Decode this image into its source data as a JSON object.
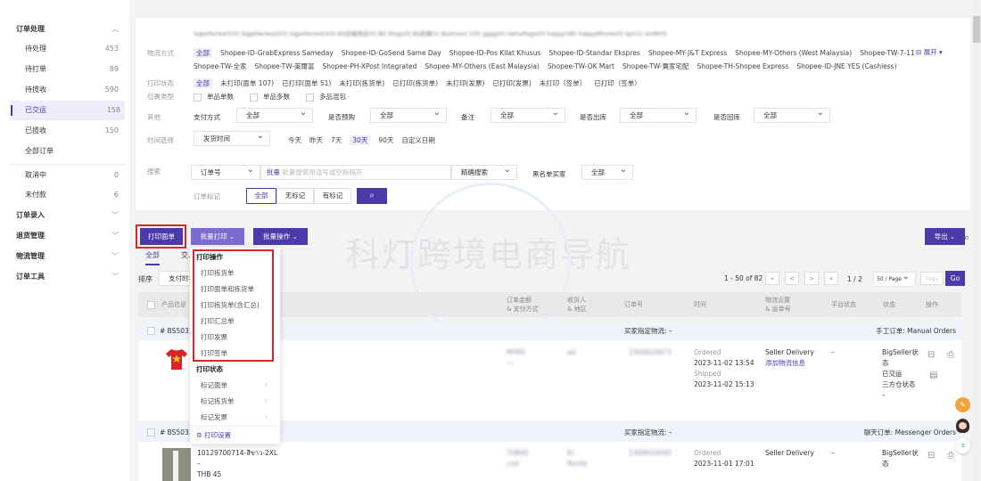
{
  "sidebar": {
    "groups": [
      {
        "label": "订单处理",
        "items": [
          {
            "label": "待处理",
            "count": "453"
          },
          {
            "label": "待打单",
            "count": "89"
          },
          {
            "label": "待揽收",
            "count": "590"
          },
          {
            "label": "已交运",
            "count": "158"
          },
          {
            "label": "已揽收",
            "count": "150"
          },
          {
            "label": "全部订单",
            "count": ""
          },
          {
            "label": "取消中",
            "count": "0"
          },
          {
            "label": "未付款",
            "count": "6"
          }
        ]
      },
      {
        "label": "订单录入"
      },
      {
        "label": "退货管理"
      },
      {
        "label": "物流管理"
      },
      {
        "label": "订单工具"
      }
    ]
  },
  "filters": {
    "store_row_blurred": "Sqpellerlest1(0)  Sqpellerlest2(0)  Sqpellerlest3(0)  BS店铺测试(0)  BS Shop(0)  BS店铺(1)  Business 1(0)  gggg(0)  HahaPage(0)  happy(48)  happyMinnie(0)  Ipn(1)  IanM(0)",
    "expand_label": "展开",
    "logistics": {
      "label": "物流方式",
      "options": [
        "全部",
        "Shopee-ID-GrabExpress Sameday",
        "Shopee-ID-GoSend Same Day",
        "Shopee-ID-Pos Kilat Khusus",
        "Shopee-ID-Standar Ekspres",
        "Shopee-MY-J&T Express",
        "Shopee-MY-Others (West Malaysia)",
        "Shopee-TW-7-11"
      ],
      "options2": [
        "Shopee-TW-全家",
        "Shopee-TW-萊爾富",
        "Shopee-PH-XPost Integrated",
        "Shopee-MY-Others (East Malaysia)",
        "Shopee-TW-OK Mart",
        "Shopee-TW-賣家宅配",
        "Shopee-TH-Shopee Express",
        "Shopee-ID-JNE YES (Cashless)"
      ]
    },
    "print_status": {
      "label": "打印状态",
      "options": [
        "全部",
        "未打印(面单 107)",
        "已打印(面单 51)",
        "未打印(拣货单)",
        "已打印(拣货单)",
        "未打印(发票)",
        "已打印(发票)",
        "未打印（签单）",
        "已打印（签单）"
      ]
    },
    "package_type": {
      "label": "包裹类型",
      "options": [
        "单品单数",
        "单品多数",
        "多品混包"
      ]
    },
    "other": {
      "label": "其他",
      "fields": [
        {
          "label": "支付方式",
          "value": "全部"
        },
        {
          "label": "是否预购",
          "value": "全部"
        },
        {
          "label": "备注",
          "value": "全部"
        },
        {
          "label": "是否出库",
          "value": "全部"
        },
        {
          "label": "是否回库",
          "value": "全部"
        }
      ]
    },
    "time": {
      "label": "时间选择",
      "select": "发货时间",
      "options": [
        "今天",
        "昨天",
        "7天",
        "30天",
        "90天",
        "自定义日期"
      ]
    },
    "search": {
      "label": "搜索",
      "field": "订单号",
      "batch": "批量",
      "placeholder": "批量搜索用逗号或空格隔开",
      "mode": "精确搜索",
      "blacklist_label": "黑名单买家",
      "blacklist_value": "全部"
    },
    "mark": {
      "label": "订单标记",
      "options": [
        "全部",
        "无标记",
        "有标记"
      ]
    }
  },
  "actions": {
    "print_label": "打印面单",
    "batch_print": "批量打印",
    "batch_ops": "批量操作",
    "export": "导出"
  },
  "watermark": "科灯跨境电商导航",
  "tabs": [
    "全部",
    "交..."
  ],
  "sort": {
    "label": "排序",
    "value": "支付时手..."
  },
  "pagination": {
    "range": "1 - 50 of 82",
    "first": "«",
    "prev": "<",
    "next": ">",
    "last": "»",
    "page": "1 / 2",
    "per_page": "50 / Page",
    "page_placeholder": "Page",
    "go": "Go"
  },
  "table": {
    "headers": {
      "product": "产品信息",
      "amount": "订单金额",
      "amount2": "& 支付方式",
      "receiver": "收货人",
      "receiver2": "& 地区",
      "order_no": "订单号",
      "time": "时间",
      "logistics": "物流设置",
      "logistics2": "& 运单号",
      "platform_status": "平台状态",
      "status": "状态",
      "ops": "操作"
    },
    "orders": [
      {
        "id": "# BS5033",
        "buyer_logistics": "买家指定物流: –",
        "type": "手工订单: Manual Orders",
        "ordered_label": "Ordered",
        "ordered": "2023-11-02 13:54",
        "shipped_label": "Shipped",
        "shipped": "2023-11-02 15:13",
        "logistics": "Seller Delivery",
        "logistics_link": "添加物流信息",
        "platform_status": "–",
        "status": [
          "BigSeller状态",
          "已交运",
          "三方仓状态",
          "–"
        ]
      },
      {
        "id": "# BS5033",
        "buyer_logistics": "买家指定物流: –",
        "type": "聊天订单: Messenger Orders",
        "product": "10129700714-สีขาว-2XL",
        "product_dash": "–",
        "price": "THB 45",
        "ordered_label": "Ordered",
        "ordered": "2023-11-01 17:01",
        "logistics": "Seller Delivery",
        "platform_status": "–",
        "status": [
          "BigSeller状态"
        ]
      }
    ]
  },
  "menu": {
    "section1": "打印操作",
    "ops": [
      "打印拣货单",
      "打印面单和拣货单",
      "打印拣货单(含汇总)",
      "打印汇总单",
      "打印发票",
      "打印签单"
    ],
    "section2": "打印状态",
    "marks": [
      "标记面单",
      "标记拣货单",
      "标记发票"
    ],
    "settings": "打印设置"
  },
  "colors": {
    "primary": "#4b3aa8",
    "highlight": "#d8262c"
  }
}
